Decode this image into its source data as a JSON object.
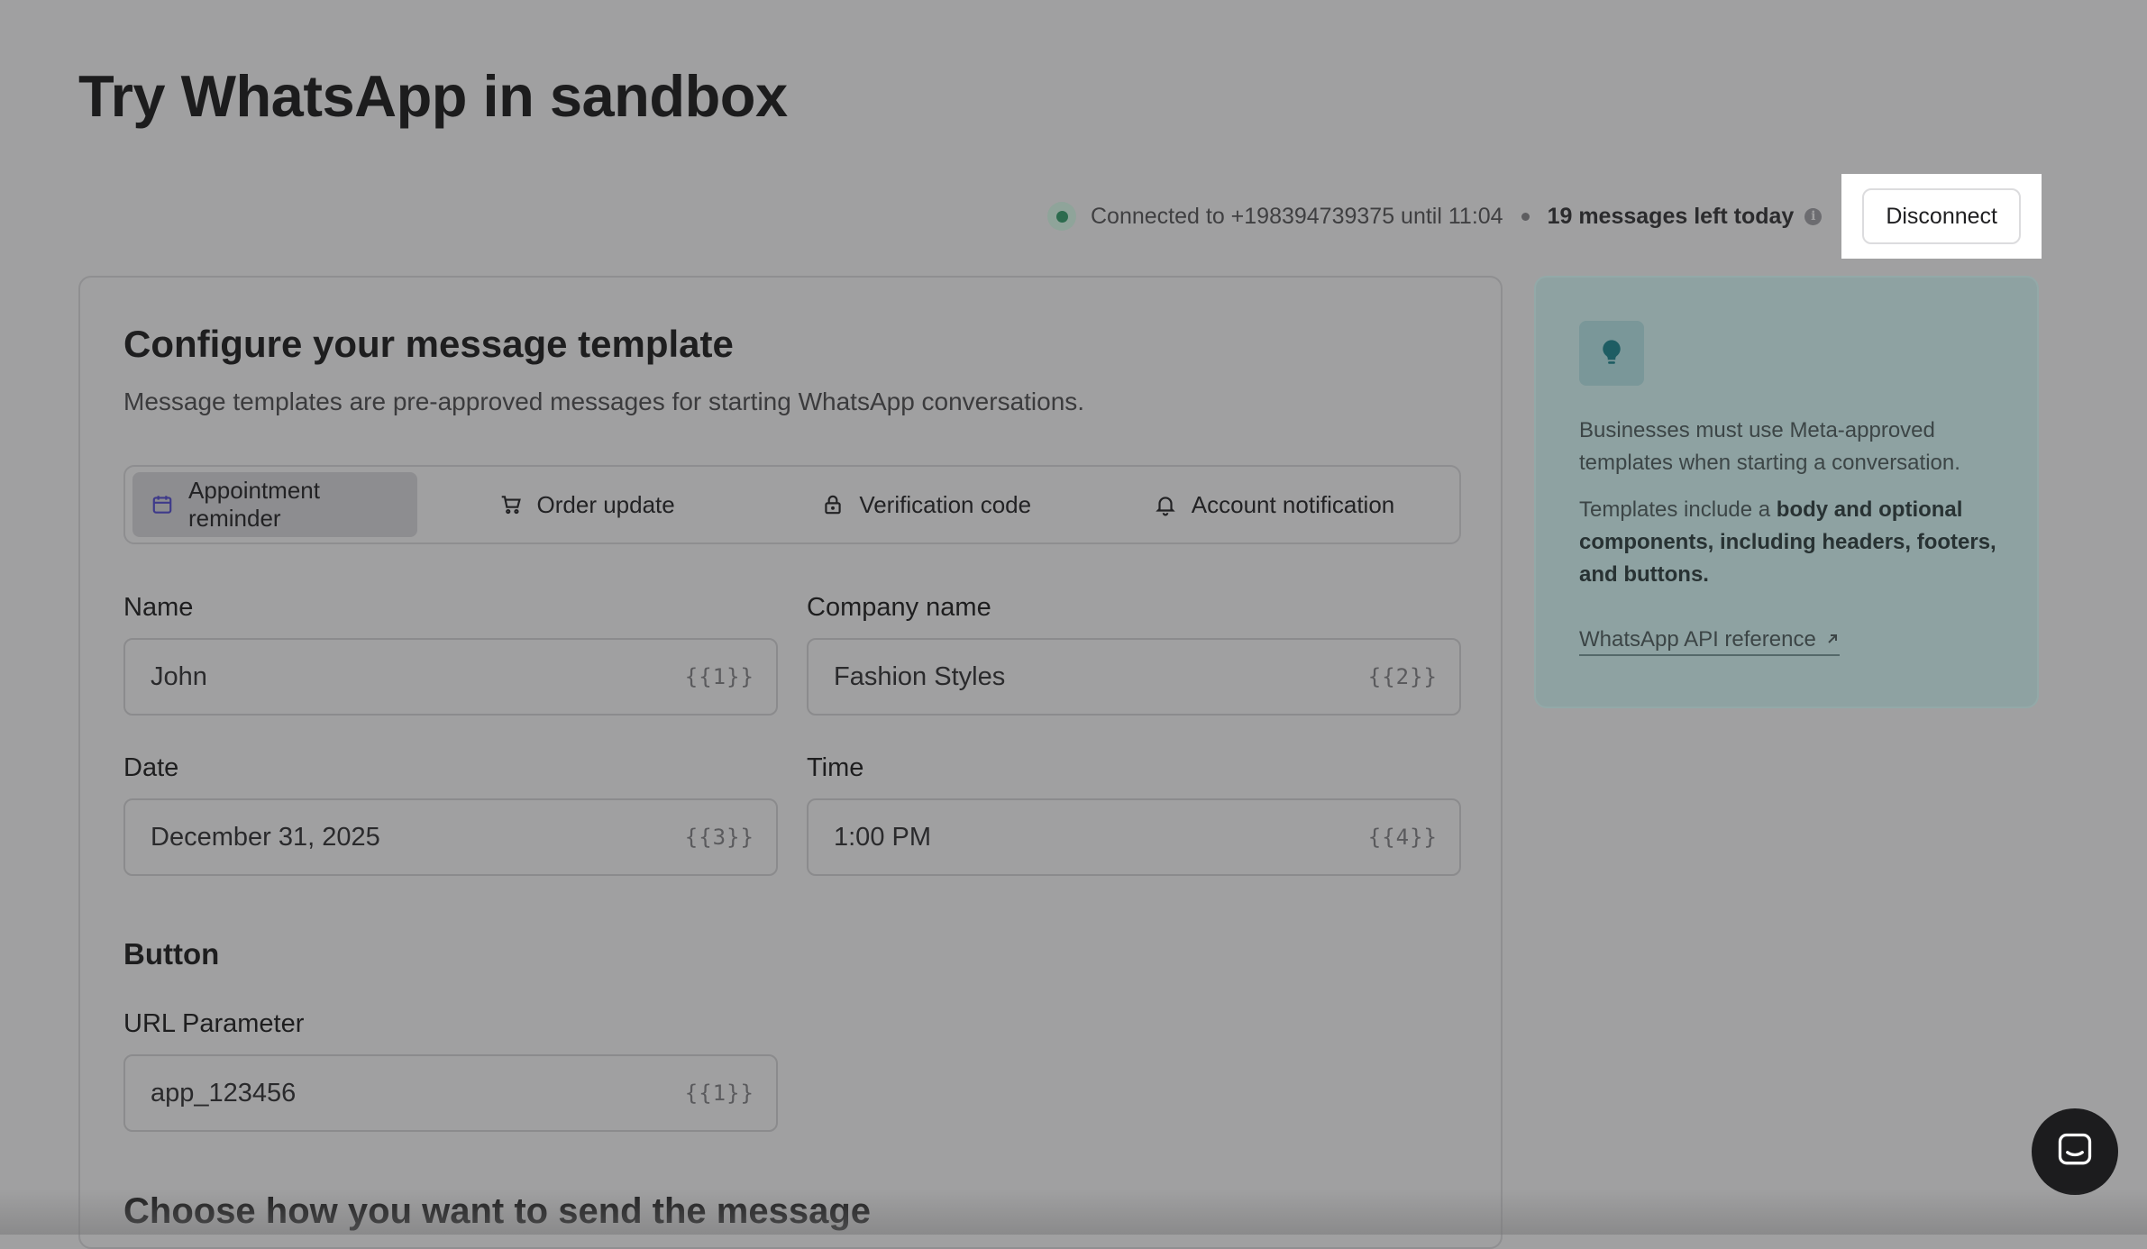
{
  "page": {
    "title": "Try WhatsApp in sandbox"
  },
  "status": {
    "connected_text": "Connected to +198394739375 until 11:04",
    "messages_left": "19 messages left today",
    "info_icon": "info-icon",
    "disconnect_label": "Disconnect"
  },
  "configure": {
    "title": "Configure your message template",
    "description": "Message templates are pre-approved messages for starting WhatsApp conversations.",
    "tabs": [
      {
        "label": "Appointment reminder",
        "icon": "calendar-icon",
        "active": true
      },
      {
        "label": "Order update",
        "icon": "cart-icon",
        "active": false
      },
      {
        "label": "Verification code",
        "icon": "lock-icon",
        "active": false
      },
      {
        "label": "Account notification",
        "icon": "bell-icon",
        "active": false
      }
    ],
    "fields": {
      "name": {
        "label": "Name",
        "value": "John",
        "placeholder": "{{1}}"
      },
      "company": {
        "label": "Company name",
        "value": "Fashion Styles",
        "placeholder": "{{2}}"
      },
      "date": {
        "label": "Date",
        "value": "December 31, 2025",
        "placeholder": "{{3}}"
      },
      "time": {
        "label": "Time",
        "value": "1:00 PM",
        "placeholder": "{{4}}"
      }
    },
    "button_section": {
      "heading": "Button",
      "url_param": {
        "label": "URL Parameter",
        "value": "app_123456",
        "placeholder": "{{1}}"
      }
    },
    "send_heading": "Choose how you want to send the message"
  },
  "side": {
    "icon": "lightbulb-icon",
    "p1": "Businesses must use Meta-approved templates when starting a conversation.",
    "p2_prefix": "Templates include a ",
    "p2_bold": "body and optional components, including headers, footers, and buttons.",
    "link_label": "WhatsApp API reference",
    "link_icon": "external-arrow-icon"
  },
  "chat": {
    "icon": "chat-icon"
  },
  "colors": {
    "overlay": "#a0a0a1",
    "status_green": "#2c6b4e",
    "side_teal": "#8ea2a2",
    "bulb_teal": "#1e5d63"
  }
}
